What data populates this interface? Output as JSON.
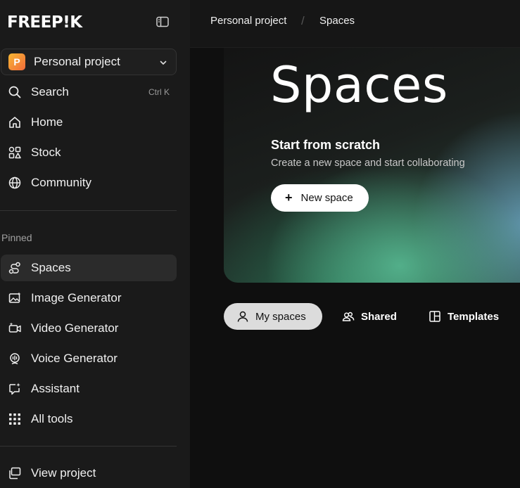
{
  "brand": {
    "logo_text": "FREEP!K"
  },
  "project": {
    "avatar_letter": "P",
    "name": "Personal project"
  },
  "nav": {
    "search": {
      "label": "Search",
      "shortcut": "Ctrl K"
    },
    "home": "Home",
    "stock": "Stock",
    "community": "Community"
  },
  "pinned": {
    "heading": "Pinned",
    "items": [
      "Spaces",
      "Image Generator",
      "Video Generator",
      "Voice Generator",
      "Assistant",
      "All tools"
    ]
  },
  "footer": {
    "view_project": "View project"
  },
  "breadcrumb": {
    "parent": "Personal project",
    "separator": "/",
    "current": "Spaces"
  },
  "hero": {
    "title": "Spaces",
    "subtitle": "Start from scratch",
    "description": "Create a new space and start collaborating",
    "new_button": "New space",
    "new_button_icon": "+"
  },
  "tabs": [
    {
      "label": "My spaces",
      "active": true
    },
    {
      "label": "Shared",
      "active": false
    },
    {
      "label": "Templates",
      "active": false
    }
  ],
  "colors": {
    "sidebar_bg": "#1a1a1a",
    "main_bg": "#0f0f0f",
    "active_tab": "#dcdcdc",
    "avatar": "#f7b733"
  }
}
